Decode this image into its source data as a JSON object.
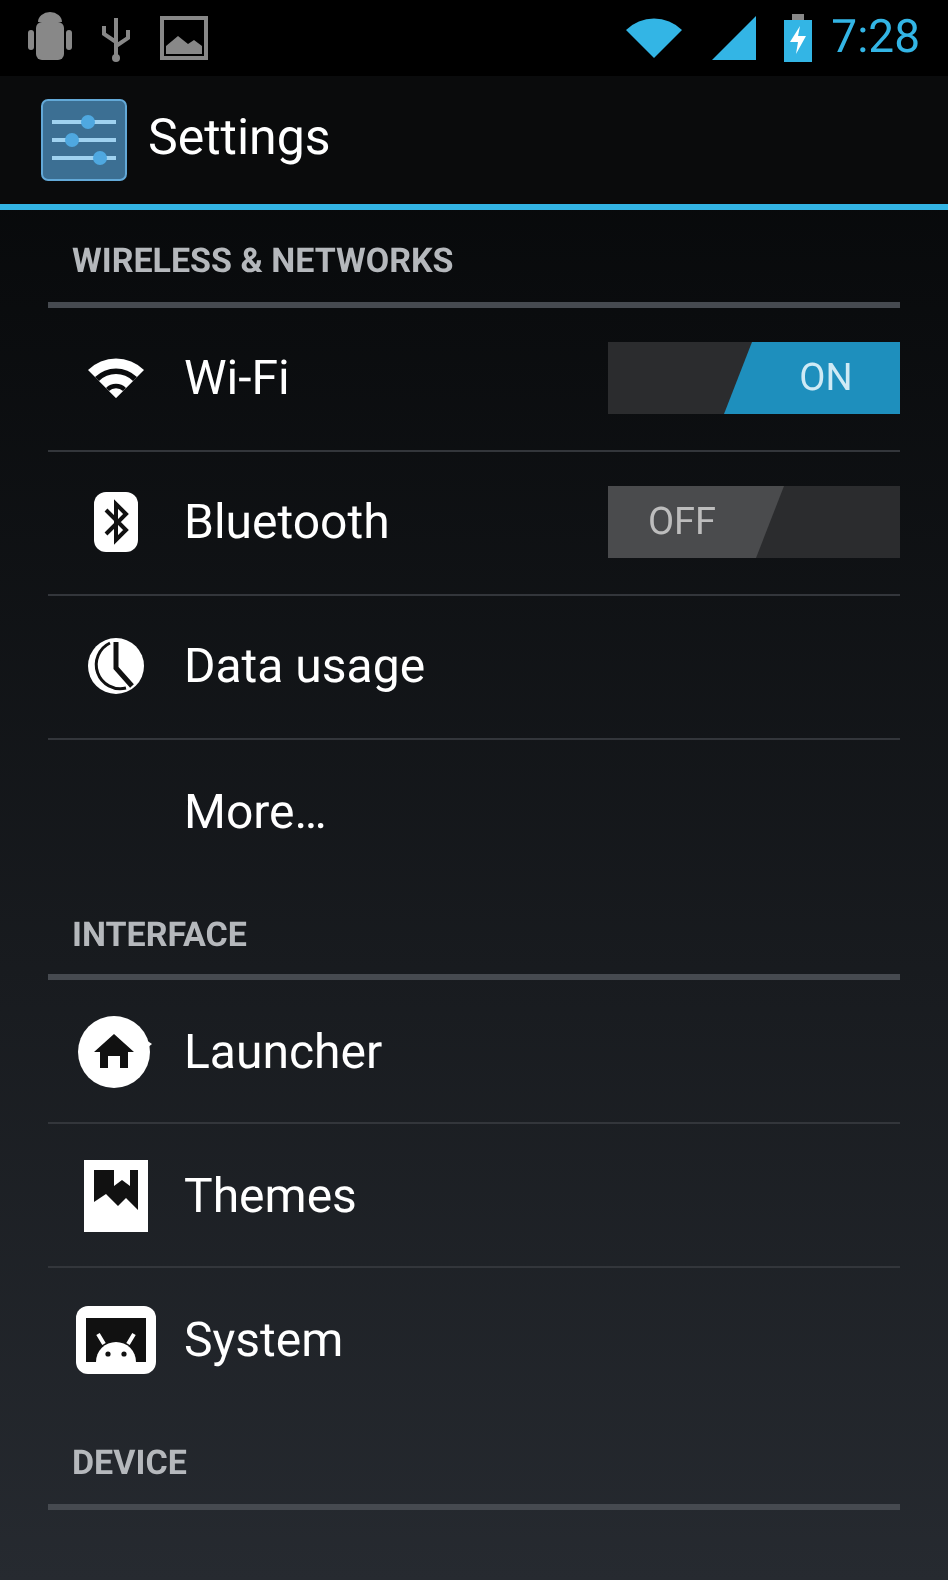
{
  "status_bar": {
    "time": "7:28"
  },
  "action_bar": {
    "title": "Settings"
  },
  "sections": [
    {
      "header": "WIRELESS & NETWORKS",
      "items": [
        {
          "label": "Wi-Fi",
          "kind": "toggle",
          "on": true,
          "toggle_text": "ON"
        },
        {
          "label": "Bluetooth",
          "kind": "toggle",
          "on": false,
          "toggle_text": "OFF"
        },
        {
          "label": "Data usage",
          "kind": "plain"
        },
        {
          "label": "More…",
          "kind": "plain"
        }
      ]
    },
    {
      "header": "INTERFACE",
      "items": [
        {
          "label": "Launcher",
          "kind": "plain"
        },
        {
          "label": "Themes",
          "kind": "plain"
        },
        {
          "label": "System",
          "kind": "plain"
        }
      ]
    },
    {
      "header": "DEVICE"
    }
  ]
}
